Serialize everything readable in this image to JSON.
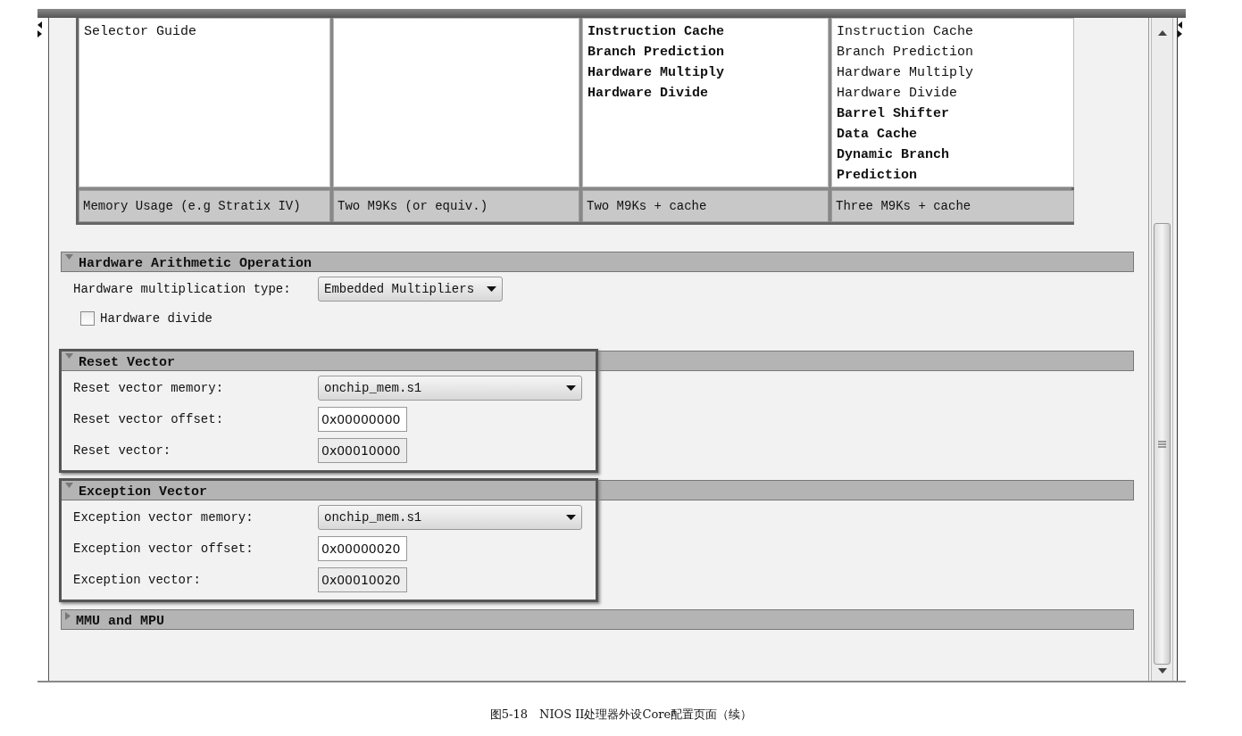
{
  "selector_table": {
    "columns": [
      {
        "features": [
          {
            "text": "Selector Guide",
            "bold": false
          }
        ],
        "memory": "Memory Usage (e.g Stratix IV)"
      },
      {
        "memory": "Two M9Ks (or equiv.)"
      },
      {
        "features": [
          {
            "text": "Instruction Cache",
            "bold": true
          },
          {
            "text": "Branch Prediction",
            "bold": true
          },
          {
            "text": "Hardware Multiply",
            "bold": true
          },
          {
            "text": "Hardware Divide",
            "bold": true
          }
        ],
        "memory": "Two M9Ks + cache"
      },
      {
        "features": [
          {
            "text": "Instruction Cache",
            "bold": false
          },
          {
            "text": "Branch Prediction",
            "bold": false
          },
          {
            "text": "Hardware Multiply",
            "bold": false
          },
          {
            "text": "Hardware Divide",
            "bold": false
          },
          {
            "text": "Barrel Shifter",
            "bold": true
          },
          {
            "text": "Data Cache",
            "bold": true
          },
          {
            "text": "Dynamic Branch",
            "bold": true
          },
          {
            "text": "Prediction",
            "bold": true
          }
        ],
        "memory": "Three M9Ks + cache"
      }
    ]
  },
  "sections": [
    {
      "title": "Hardware Arithmetic Operation",
      "expanded": true,
      "framed": false,
      "fields": [
        {
          "kind": "dropdown",
          "label": "Hardware multiplication type:",
          "value": "Embedded Multipliers"
        },
        {
          "kind": "checkbox",
          "label": "Hardware divide",
          "checked": false
        }
      ]
    },
    {
      "title": "Reset Vector",
      "expanded": true,
      "framed": true,
      "fields": [
        {
          "kind": "dropdown",
          "label": "Reset vector memory:",
          "value": "onchip_mem.s1"
        },
        {
          "kind": "text",
          "label": "Reset vector offset:",
          "value": "0x00000000",
          "disabled": false
        },
        {
          "kind": "text",
          "label": "Reset vector:",
          "value": "0x00010000",
          "disabled": true
        }
      ]
    },
    {
      "title": "Exception Vector",
      "expanded": true,
      "framed": true,
      "fields": [
        {
          "kind": "dropdown",
          "label": "Exception vector memory:",
          "value": "onchip_mem.s1"
        },
        {
          "kind": "text",
          "label": "Exception vector offset:",
          "value": "0x00000020",
          "disabled": false
        },
        {
          "kind": "text",
          "label": "Exception vector:",
          "value": "0x00010020",
          "disabled": true
        }
      ]
    },
    {
      "title": "MMU and MPU",
      "expanded": false,
      "framed": false
    }
  ],
  "caption": "图5-18　NIOS II处理器外设Core配置页面（续）"
}
